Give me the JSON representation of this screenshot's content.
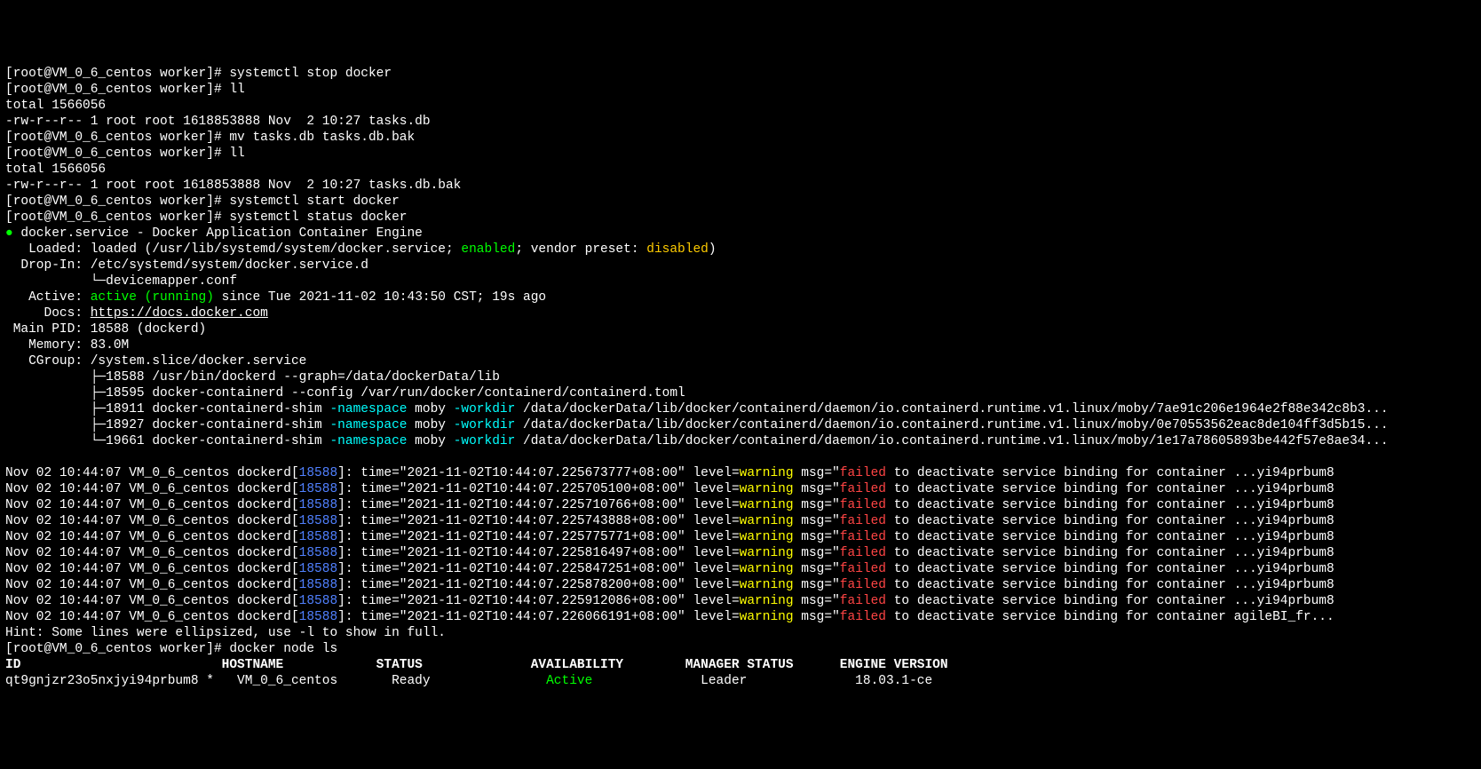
{
  "prompt1": "[root@VM_0_6_centos worker]# systemctl stop docker",
  "prompt2": "[root@VM_0_6_centos worker]# ll",
  "total1": "total 1566056",
  "ls1": "-rw-r--r-- 1 root root 1618853888 Nov  2 10:27 tasks.db",
  "prompt3": "[root@VM_0_6_centos worker]# mv tasks.db tasks.db.bak",
  "prompt4": "[root@VM_0_6_centos worker]# ll",
  "total2": "total 1566056",
  "ls2": "-rw-r--r-- 1 root root 1618853888 Nov  2 10:27 tasks.db.bak",
  "prompt5": "[root@VM_0_6_centos worker]# systemctl start docker",
  "prompt6": "[root@VM_0_6_centos worker]# systemctl status docker",
  "svc_bullet": "●",
  "svc_head": " docker.service - Docker Application Container Engine",
  "loaded_pre": "   Loaded: loaded (/usr/lib/systemd/system/docker.service; ",
  "loaded_en": "enabled",
  "loaded_mid": "; vendor preset: ",
  "loaded_dis": "disabled",
  "loaded_end": ")",
  "dropin": "  Drop-In: /etc/systemd/system/docker.service.d",
  "dropin2": "           └─devicemapper.conf",
  "active_pre": "   Active: ",
  "active_val": "active (running)",
  "active_post": " since Tue 2021-11-02 10:43:50 CST; 19s ago",
  "docs_pre": "     Docs: ",
  "docs_url": "https://docs.docker.com",
  "mainpid": " Main PID: 18588 (dockerd)",
  "memory": "   Memory: 83.0M",
  "cgroup": "   CGroup: /system.slice/docker.service",
  "ctree1": "           ├─18588 /usr/bin/dockerd --graph=/data/dockerData/lib",
  "ctree2": "           ├─18595 docker-containerd --config /var/run/docker/containerd/containerd.toml",
  "ctree3a": "           ├─18911 docker-containerd-shim ",
  "ctree3b": "-namespace",
  "ctree3c": " moby ",
  "ctree3d": "-workdir",
  "ctree3e": " /data/dockerData/lib/docker/containerd/daemon/io.containerd.runtime.v1.linux/moby/7ae91c206e1964e2f88e342c8b3...",
  "ctree4a": "           ├─18927 docker-containerd-shim ",
  "ctree4e": " /data/dockerData/lib/docker/containerd/daemon/io.containerd.runtime.v1.linux/moby/0e70553562eac8de104ff3d5b15...",
  "ctree5a": "           └─19661 docker-containerd-shim ",
  "ctree5e": " /data/dockerData/lib/docker/containerd/daemon/io.containerd.runtime.v1.linux/moby/1e17a78605893be442f57e8ae34...",
  "log_prefix": "Nov 02 10:44:07 VM_0_6_centos dockerd[",
  "log_pid": "18588",
  "log_brk": "]",
  "log_mid1": ": time=\"2021-11-02T10:44:07.",
  "log_mid2": "+08:00\" level=",
  "log_warn": "warning",
  "log_msg1": " msg=\"",
  "log_fail": "failed",
  "log_tail_a": " to deactivate service binding for container ...yi94prbum8",
  "log_tail_b": " to deactivate service binding for container agileBI_fr...",
  "ts": [
    "225673777",
    "225705100",
    "225710766",
    "225743888",
    "225775771",
    "225816497",
    "225847251",
    "225878200",
    "225912086",
    "226066191"
  ],
  "tails": [
    "a",
    "a",
    "a",
    "a",
    "a",
    "a",
    "a",
    "a",
    "a",
    "b"
  ],
  "hint": "Hint: Some lines were ellipsized, use -l to show in full.",
  "prompt7": "[root@VM_0_6_centos worker]# docker node ls",
  "th": "ID                          HOSTNAME            STATUS              AVAILABILITY        MANAGER STATUS      ENGINE VERSION",
  "row_a": "qt9gnjzr23o5nxjyi94prbum8 *   VM_0_6_centos       Ready               ",
  "row_active": "Active",
  "row_b": "              Leader              18.03.1-ce"
}
